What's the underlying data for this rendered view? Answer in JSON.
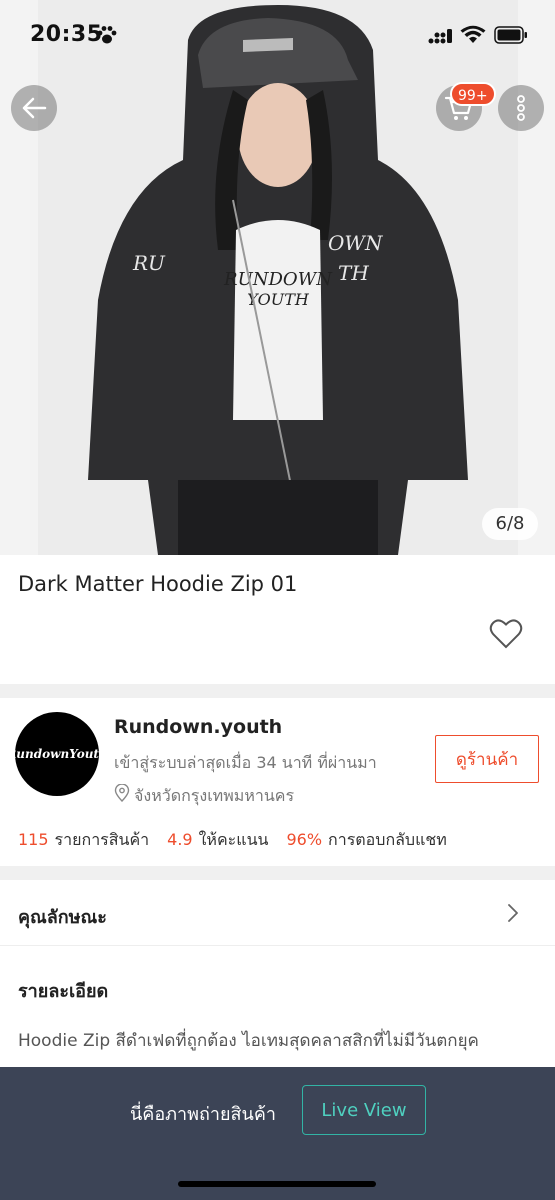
{
  "status_bar": {
    "time": "20:35"
  },
  "header": {
    "cart_badge": "99+"
  },
  "gallery": {
    "counter": "6/8"
  },
  "product": {
    "title": "Dark Matter Hoodie Zip 01"
  },
  "shop": {
    "logo_text": "RundownYouth",
    "name": "Rundown.youth",
    "last_seen": "เข้าสู่ระบบล่าสุดเมื่อ 34 นาที ที่ผ่านมา",
    "location": "จังหวัดกรุงเทพมหานคร",
    "view_shop_label": "ดูร้านค้า",
    "stats": [
      {
        "value": "115",
        "label": "รายการสินค้า"
      },
      {
        "value": "4.9",
        "label": "ให้คะแนน"
      },
      {
        "value": "96%",
        "label": "การตอบกลับแชท"
      }
    ]
  },
  "attributes": {
    "label": "คุณลักษณะ"
  },
  "details": {
    "heading": "รายละเอียด",
    "text": "Hoodie Zip สีดำเฟดที่ถูกต้อง ไอเทมสุดคลาสสิกที่ไม่มีวันตกยุค"
  },
  "banner": {
    "text": "นี่คือภาพถ่ายสินค้า",
    "live_view_label": "Live View"
  },
  "colors": {
    "accent": "#ee4d2d",
    "banner_bg": "#3c4456",
    "live_view": "#32b4a5"
  }
}
